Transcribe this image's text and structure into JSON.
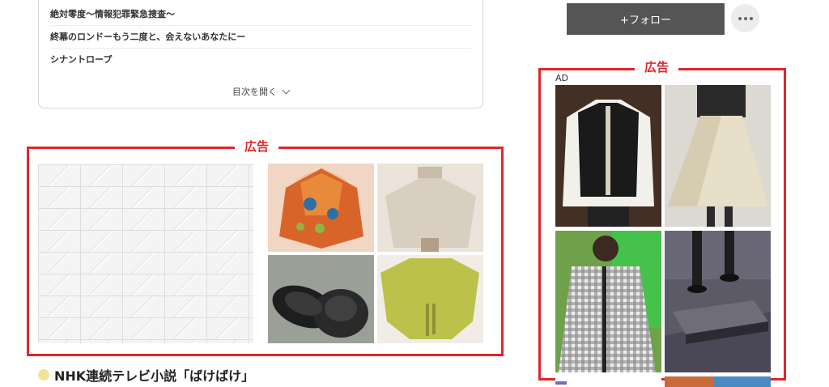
{
  "toc": {
    "items": [
      "絶対零度〜情報犯罪緊急捜査〜",
      "終幕のロンドーもう二度と、会えないあなたにー",
      "シナントロープ"
    ],
    "open_label": "目次を開く"
  },
  "ads": {
    "label": "広告",
    "ad_tag": "AD"
  },
  "sidebar": {
    "follow_label": "+フォロー"
  },
  "section": {
    "heading": "NHK連続テレビ小説「ばけばけ」"
  },
  "colors": {
    "ad_red": "#e0262b",
    "follow_bg": "#555555",
    "heading_dot": "#f2e29b"
  }
}
